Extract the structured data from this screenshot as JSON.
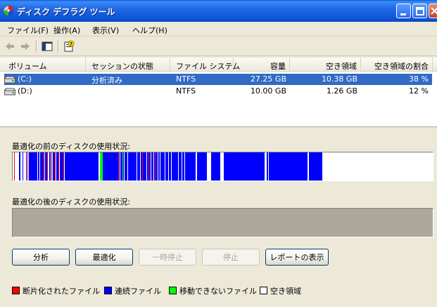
{
  "window": {
    "title": "ディスク デフラグ ツール",
    "colors": {
      "titlebar": "#2168e8",
      "selection": "#316ac5"
    }
  },
  "menu": {
    "items": [
      {
        "label": "ファイル(F)"
      },
      {
        "label": "操作(A)"
      },
      {
        "label": "表示(V)"
      },
      {
        "label": "ヘルプ(H)"
      }
    ]
  },
  "toolbar": {
    "icons": [
      "back-arrow-icon",
      "forward-arrow-icon",
      "show-hide-console-tree-icon",
      "help-properties-icon"
    ]
  },
  "volumes": {
    "columns": [
      "ボリューム",
      "セッションの状態",
      "ファイル システム",
      "容量",
      "空き領域",
      "空き領域の割合"
    ],
    "rows": [
      {
        "volume": "(C:)",
        "status": "分析済み",
        "fs": "NTFS",
        "capacity": "27.25 GB",
        "free": "10.38 GB",
        "percent": "38 %",
        "selected": true
      },
      {
        "volume": "(D:)",
        "status": "",
        "fs": "NTFS",
        "capacity": "10.00 GB",
        "free": "1.26 GB",
        "percent": "12 %",
        "selected": false
      }
    ]
  },
  "analysis": {
    "before_label": "最適化の前のディスクの使用状況:",
    "after_label": "最適化の後のディスクの使用状況:",
    "colors": {
      "fragmented": "#ff0000",
      "contiguous": "#0000ff",
      "unmovable": "#00ff00",
      "free": "#ffffff",
      "after_bg": "#aca899"
    }
  },
  "buttons": {
    "analyze": "分析",
    "defragment": "最適化",
    "pause": "一時停止",
    "stop": "停止",
    "view_report": "レポートの表示"
  },
  "legend": {
    "fragmented": "断片化されたファイル",
    "contiguous": "連続ファイル",
    "unmovable": "移動できないファイル",
    "free": "空き領域"
  }
}
